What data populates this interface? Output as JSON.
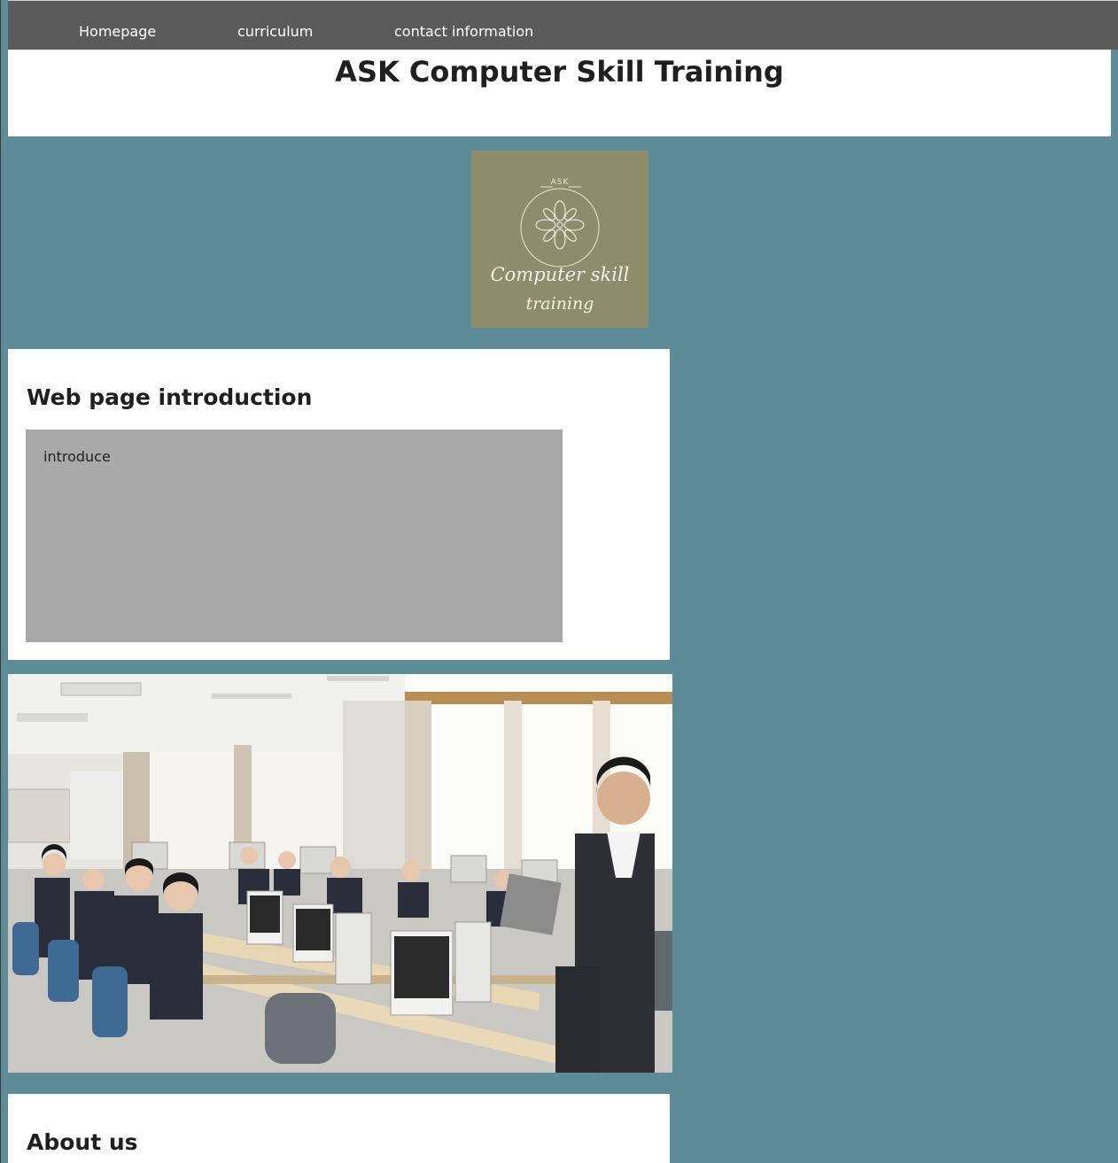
{
  "nav": {
    "items": [
      {
        "label": "Homepage"
      },
      {
        "label": "curriculum"
      },
      {
        "label": "contact information"
      }
    ]
  },
  "header": {
    "title": "ASK Computer Skill Training"
  },
  "logo": {
    "top_text": "ASK",
    "line1": "Computer skill",
    "line2": "training",
    "icon": "flower-emblem-icon",
    "background_color": "#8b8d6d"
  },
  "intro": {
    "heading": "Web page introduction",
    "body": "introduce"
  },
  "photo": {
    "description_icon": "classroom-photo"
  },
  "about": {
    "heading": "About us"
  },
  "colors": {
    "page_background": "#5d8c98",
    "navbar": "#5a5a5a",
    "intro_box": "#a9a9a9"
  }
}
